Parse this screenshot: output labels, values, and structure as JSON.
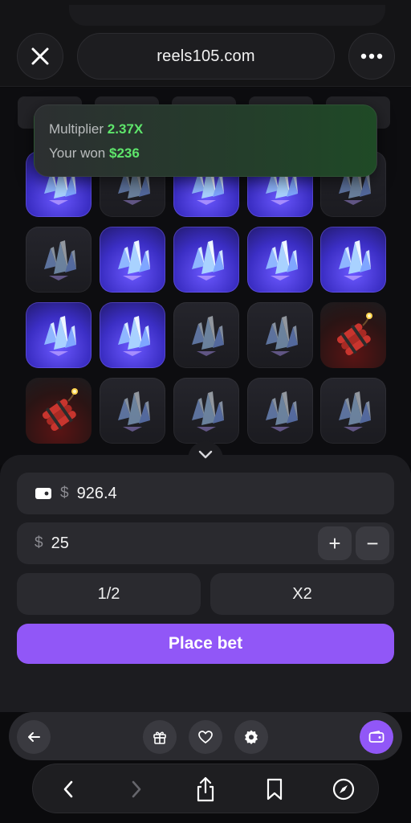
{
  "browser": {
    "url": "reels105.com",
    "close_icon": "close-icon",
    "more_icon": "more-dots-icon"
  },
  "toast": {
    "multiplier_label": "Multiplier",
    "multiplier_value": "2.37X",
    "won_label": "Your won",
    "won_value": "$236",
    "accent": "#5ee66b"
  },
  "grid": {
    "rows": [
      [
        "gem",
        "dim",
        "gem",
        "gem",
        "dim"
      ],
      [
        "dim",
        "gem",
        "gem",
        "gem",
        "gem"
      ],
      [
        "gem",
        "gem",
        "dim",
        "dim",
        "bomb"
      ],
      [
        "bomb",
        "dim",
        "dim",
        "dim",
        "dim"
      ]
    ]
  },
  "bet": {
    "currency": "$",
    "balance": "926.4",
    "amount": "25",
    "plus": "+",
    "minus": "−",
    "half_label": "1/2",
    "double_label": "X2",
    "place_bet_label": "Place bet",
    "accent": "#9157f7"
  },
  "game_nav": {
    "icons": [
      "arrow-left-icon",
      "gift-icon",
      "heart-icon",
      "gear-icon",
      "wallet-icon"
    ]
  },
  "toolbar": {
    "icons": [
      "back-chevron-icon",
      "forward-chevron-icon",
      "share-icon",
      "bookmark-icon",
      "compass-icon"
    ]
  }
}
